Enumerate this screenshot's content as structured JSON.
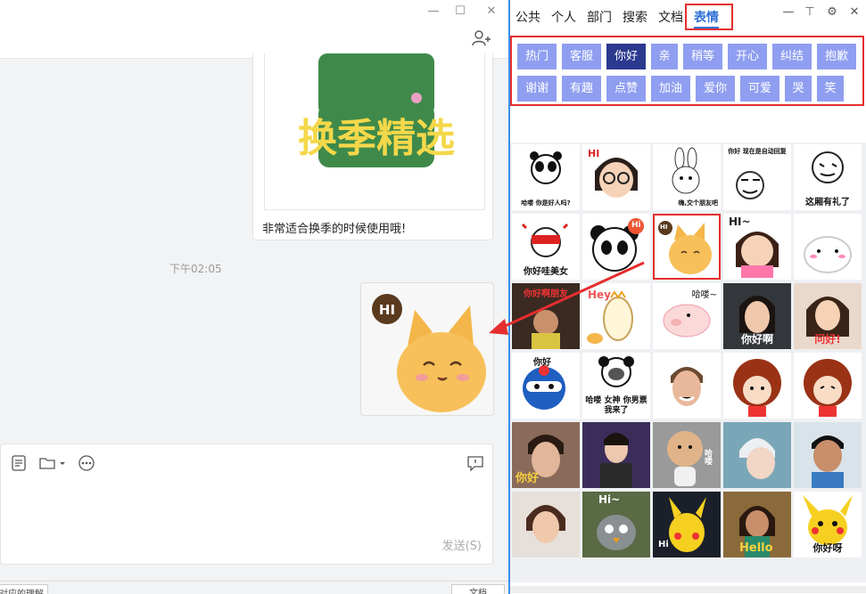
{
  "chat": {
    "card_caption": "非常适合换季的时候使用哦!",
    "sticker_text": "换季精选",
    "timestamp": "下午02:05",
    "sent_sticker_badge": "HI",
    "send_label": "发送(S)",
    "bottom_left": "对应的理解",
    "bottom_right": "文档"
  },
  "panel": {
    "tabs": [
      "公共",
      "个人",
      "部门",
      "搜索",
      "文档",
      "表情"
    ],
    "active_tab": "表情",
    "categories_row1": [
      "热门",
      "客服",
      "你好",
      "亲",
      "稍等",
      "开心",
      "纠结",
      "抱歉"
    ],
    "categories_row2": [
      "谢谢",
      "有趣",
      "点赞",
      "加油",
      "爱你",
      "可爱",
      "哭",
      "笑"
    ],
    "selected_category": "你好",
    "stickers": [
      {
        "caption": "哈喽 你是好人吗?",
        "name": "panda-meme"
      },
      {
        "caption": "HI",
        "name": "girl-glasses"
      },
      {
        "caption": "嗨,交个朋友吧",
        "name": "bunny-meme"
      },
      {
        "caption": "你好 现在是自动回复",
        "name": "man-meme"
      },
      {
        "caption": "这厢有礼了",
        "name": "bowing-meme"
      },
      {
        "caption": "你好哇美女",
        "name": "masked-meme"
      },
      {
        "caption": "Hi",
        "name": "panda-cartoon"
      },
      {
        "caption": "HI",
        "name": "cat-hi"
      },
      {
        "caption": "HI~",
        "name": "girl-pink"
      },
      {
        "caption": "",
        "name": "mochi"
      },
      {
        "caption": "你好啊朋友",
        "name": "baby-photo"
      },
      {
        "caption": "Hey",
        "name": "bun-cartoon"
      },
      {
        "caption": "哈喽~",
        "name": "pig-cartoon"
      },
      {
        "caption": "你好啊",
        "name": "woman-photo-1"
      },
      {
        "caption": "问好!",
        "name": "woman-photo-2"
      },
      {
        "caption": "你好",
        "name": "ninja-cartoon"
      },
      {
        "caption": "哈喽 女神 你男票我来了",
        "name": "panda-meme-2"
      },
      {
        "caption": "",
        "name": "man-photo"
      },
      {
        "caption": "",
        "name": "curly-girl-1"
      },
      {
        "caption": "",
        "name": "curly-girl-2"
      },
      {
        "caption": "你好",
        "name": "man-photo-2"
      },
      {
        "caption": "",
        "name": "singer-photo"
      },
      {
        "caption": "哈喽",
        "name": "cartoon-baby"
      },
      {
        "caption": "",
        "name": "anime-boy"
      },
      {
        "caption": "",
        "name": "boy-wave"
      },
      {
        "caption": "",
        "name": "man-photo-3"
      },
      {
        "caption": "Hi~",
        "name": "angry-bird"
      },
      {
        "caption": "Hi",
        "name": "pikachu-1"
      },
      {
        "caption": "Hello",
        "name": "anime-girl"
      },
      {
        "caption": "你好呀",
        "name": "pikachu-2"
      }
    ]
  },
  "colors": {
    "accent": "#2f6fd6",
    "chip": "#8f9ef0",
    "chip_selected": "#2b3a8f",
    "highlight": "#e52e2e"
  }
}
